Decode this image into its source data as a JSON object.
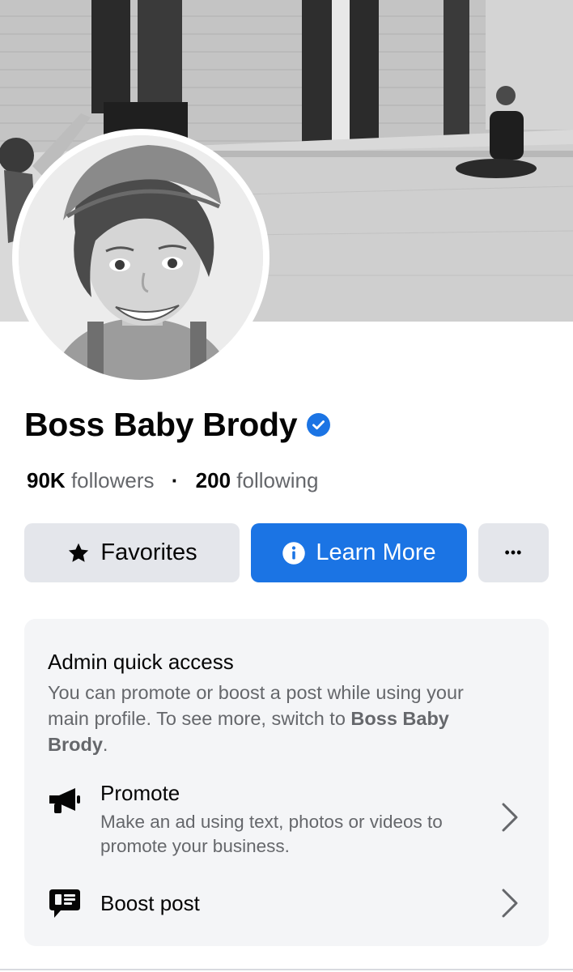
{
  "profile": {
    "name": "Boss Baby Brody",
    "verified": true,
    "followers_count": "90K",
    "followers_label": "followers",
    "separator": "·",
    "following_count": "200",
    "following_label": "following"
  },
  "actions": {
    "favorites_label": "Favorites",
    "learn_more_label": "Learn More",
    "more_label": "•••"
  },
  "admin_card": {
    "title": "Admin quick access",
    "description_text": "You can promote or boost a post while using your main profile. To see more, switch to ",
    "description_name": "Boss Baby Brody",
    "description_end": ".",
    "items": [
      {
        "label": "Promote",
        "subtitle": "Make an ad using text, photos or videos to promote your business.",
        "icon": "megaphone-icon"
      },
      {
        "label": "Boost post",
        "icon": "boost-post-icon"
      }
    ]
  },
  "colors": {
    "accent": "#1b74e4",
    "button_gray": "#e4e6eb",
    "card_bg": "#f4f5f7",
    "secondary_text": "#65676b"
  }
}
